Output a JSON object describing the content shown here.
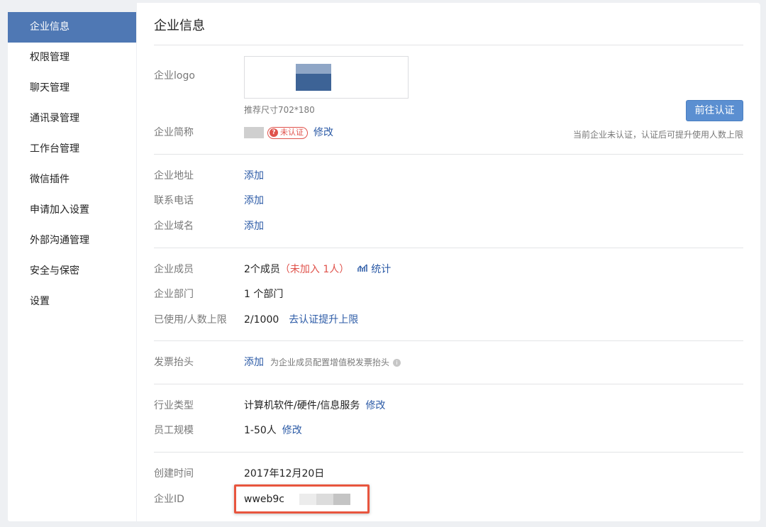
{
  "sidebar": {
    "items": [
      {
        "label": "企业信息",
        "active": true
      },
      {
        "label": "权限管理"
      },
      {
        "label": "聊天管理"
      },
      {
        "label": "通讯录管理"
      },
      {
        "label": "工作台管理"
      },
      {
        "label": "微信插件"
      },
      {
        "label": "申请加入设置"
      },
      {
        "label": "外部沟通管理"
      },
      {
        "label": "安全与保密"
      },
      {
        "label": "设置"
      }
    ]
  },
  "main": {
    "title": "企业信息",
    "logo": {
      "label": "企业logo",
      "hint": "推荐尺寸702*180"
    },
    "certify_button": "前往认证",
    "certify_note": "当前企业未认证，认证后可提升使用人数上限",
    "short_name": {
      "label": "企业简称",
      "badge": "未认证",
      "badge_icon": "?",
      "edit": "修改"
    },
    "address": {
      "label": "企业地址",
      "action": "添加"
    },
    "phone": {
      "label": "联系电话",
      "action": "添加"
    },
    "domain": {
      "label": "企业域名",
      "action": "添加"
    },
    "members": {
      "label": "企业成员",
      "value": "2个成员",
      "unjoined": "（未加入 1人）",
      "stats": "统计"
    },
    "departments": {
      "label": "企业部门",
      "value": "1 个部门"
    },
    "usage": {
      "label": "已使用/人数上限",
      "value": "2/1000",
      "action": "去认证提升上限"
    },
    "invoice": {
      "label": "发票抬头",
      "action": "添加",
      "hint": "为企业成员配置增值税发票抬头",
      "info_icon": "i"
    },
    "industry": {
      "label": "行业类型",
      "value": "计算机软件/硬件/信息服务",
      "edit": "修改"
    },
    "scale": {
      "label": "员工规模",
      "value": "1-50人",
      "edit": "修改"
    },
    "created": {
      "label": "创建时间",
      "value": "2017年12月20日"
    },
    "corp_id": {
      "label": "企业ID",
      "value": "wweb9c"
    }
  },
  "colors": {
    "accent": "#4f78b4",
    "link": "#2b5aa6",
    "warning": "#e0524b",
    "button": "#5b8fd1",
    "highlight": "#e8553e"
  }
}
